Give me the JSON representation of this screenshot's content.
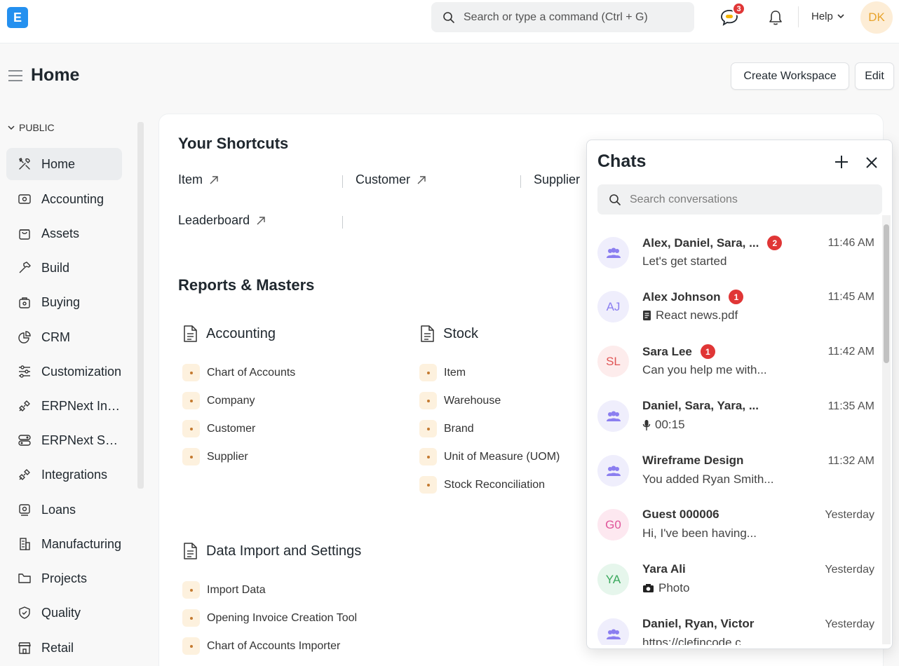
{
  "navbar": {
    "logo_letter": "E",
    "search_placeholder": "Search or type a command (Ctrl + G)",
    "chat_badge": "3",
    "help_label": "Help",
    "user_initials": "DK"
  },
  "page": {
    "title": "Home",
    "create_workspace": "Create Workspace",
    "edit": "Edit"
  },
  "sidebar": {
    "section": "PUBLIC",
    "items": [
      {
        "label": "Home",
        "icon": "tools-icon"
      },
      {
        "label": "Accounting",
        "icon": "wallet-icon"
      },
      {
        "label": "Assets",
        "icon": "bag-icon"
      },
      {
        "label": "Build",
        "icon": "hammer-icon"
      },
      {
        "label": "Buying",
        "icon": "shopping-icon"
      },
      {
        "label": "CRM",
        "icon": "pie-chart-icon"
      },
      {
        "label": "Customization",
        "icon": "sliders-icon"
      },
      {
        "label": "ERPNext Integrations",
        "icon": "plug-icon"
      },
      {
        "label": "ERPNext Settings",
        "icon": "toggle-icon"
      },
      {
        "label": "Integrations",
        "icon": "plug-icon"
      },
      {
        "label": "Loans",
        "icon": "loan-icon"
      },
      {
        "label": "Manufacturing",
        "icon": "building-icon"
      },
      {
        "label": "Projects",
        "icon": "folder-icon"
      },
      {
        "label": "Quality",
        "icon": "shield-check-icon"
      },
      {
        "label": "Retail",
        "icon": "store-icon"
      }
    ]
  },
  "main": {
    "shortcuts_title": "Your Shortcuts",
    "shortcuts": [
      "Item",
      "Customer",
      "Supplier",
      "Leaderboard"
    ],
    "reports_title": "Reports & Masters",
    "cards": [
      {
        "title": "Accounting",
        "links": [
          "Chart of Accounts",
          "Company",
          "Customer",
          "Supplier"
        ]
      },
      {
        "title": "Stock",
        "links": [
          "Item",
          "Warehouse",
          "Brand",
          "Unit of Measure (UOM)",
          "Stock Reconciliation"
        ]
      },
      {
        "title": "Data Import and Settings",
        "links": [
          "Import Data",
          "Opening Invoice Creation Tool",
          "Chart of Accounts Importer"
        ]
      }
    ]
  },
  "chats": {
    "title": "Chats",
    "search_placeholder": "Search conversations",
    "items": [
      {
        "name": "Alex, Daniel, Sara, ...",
        "badge": "2",
        "time": "11:46 AM",
        "msg": "Let's get started",
        "avatar": "group",
        "msg_icon": ""
      },
      {
        "name": "Alex Johnson",
        "badge": "1",
        "time": "11:45 AM",
        "msg": "React news.pdf",
        "avatar": "AJ",
        "msg_icon": "file-icon"
      },
      {
        "name": "Sara Lee",
        "badge": "1",
        "time": "11:42 AM",
        "msg": "Can you help me with...",
        "avatar": "SL",
        "msg_icon": ""
      },
      {
        "name": "Daniel, Sara, Yara, ...",
        "badge": "",
        "time": "11:35 AM",
        "msg": "00:15",
        "avatar": "group",
        "msg_icon": "mic-icon"
      },
      {
        "name": "Wireframe Design",
        "badge": "",
        "time": "11:32 AM",
        "msg": "You added Ryan Smith...",
        "avatar": "group",
        "msg_icon": ""
      },
      {
        "name": "Guest 000006",
        "badge": "",
        "time": "Yesterday",
        "msg": "Hi, I've been having...",
        "avatar": "G0",
        "msg_icon": ""
      },
      {
        "name": "Yara Ali",
        "badge": "",
        "time": "Yesterday",
        "msg": "Photo",
        "avatar": "YA",
        "msg_icon": "camera-icon"
      },
      {
        "name": "Daniel, Ryan, Victor",
        "badge": "",
        "time": "Yesterday",
        "msg": "https://clefincode.c...",
        "avatar": "group",
        "msg_icon": ""
      }
    ]
  },
  "colors": {
    "brand": "#2490ef",
    "badge": "#e03636",
    "group_avatar_bg": "#efeefc",
    "group_avatar_fg": "#8b7ef0"
  }
}
